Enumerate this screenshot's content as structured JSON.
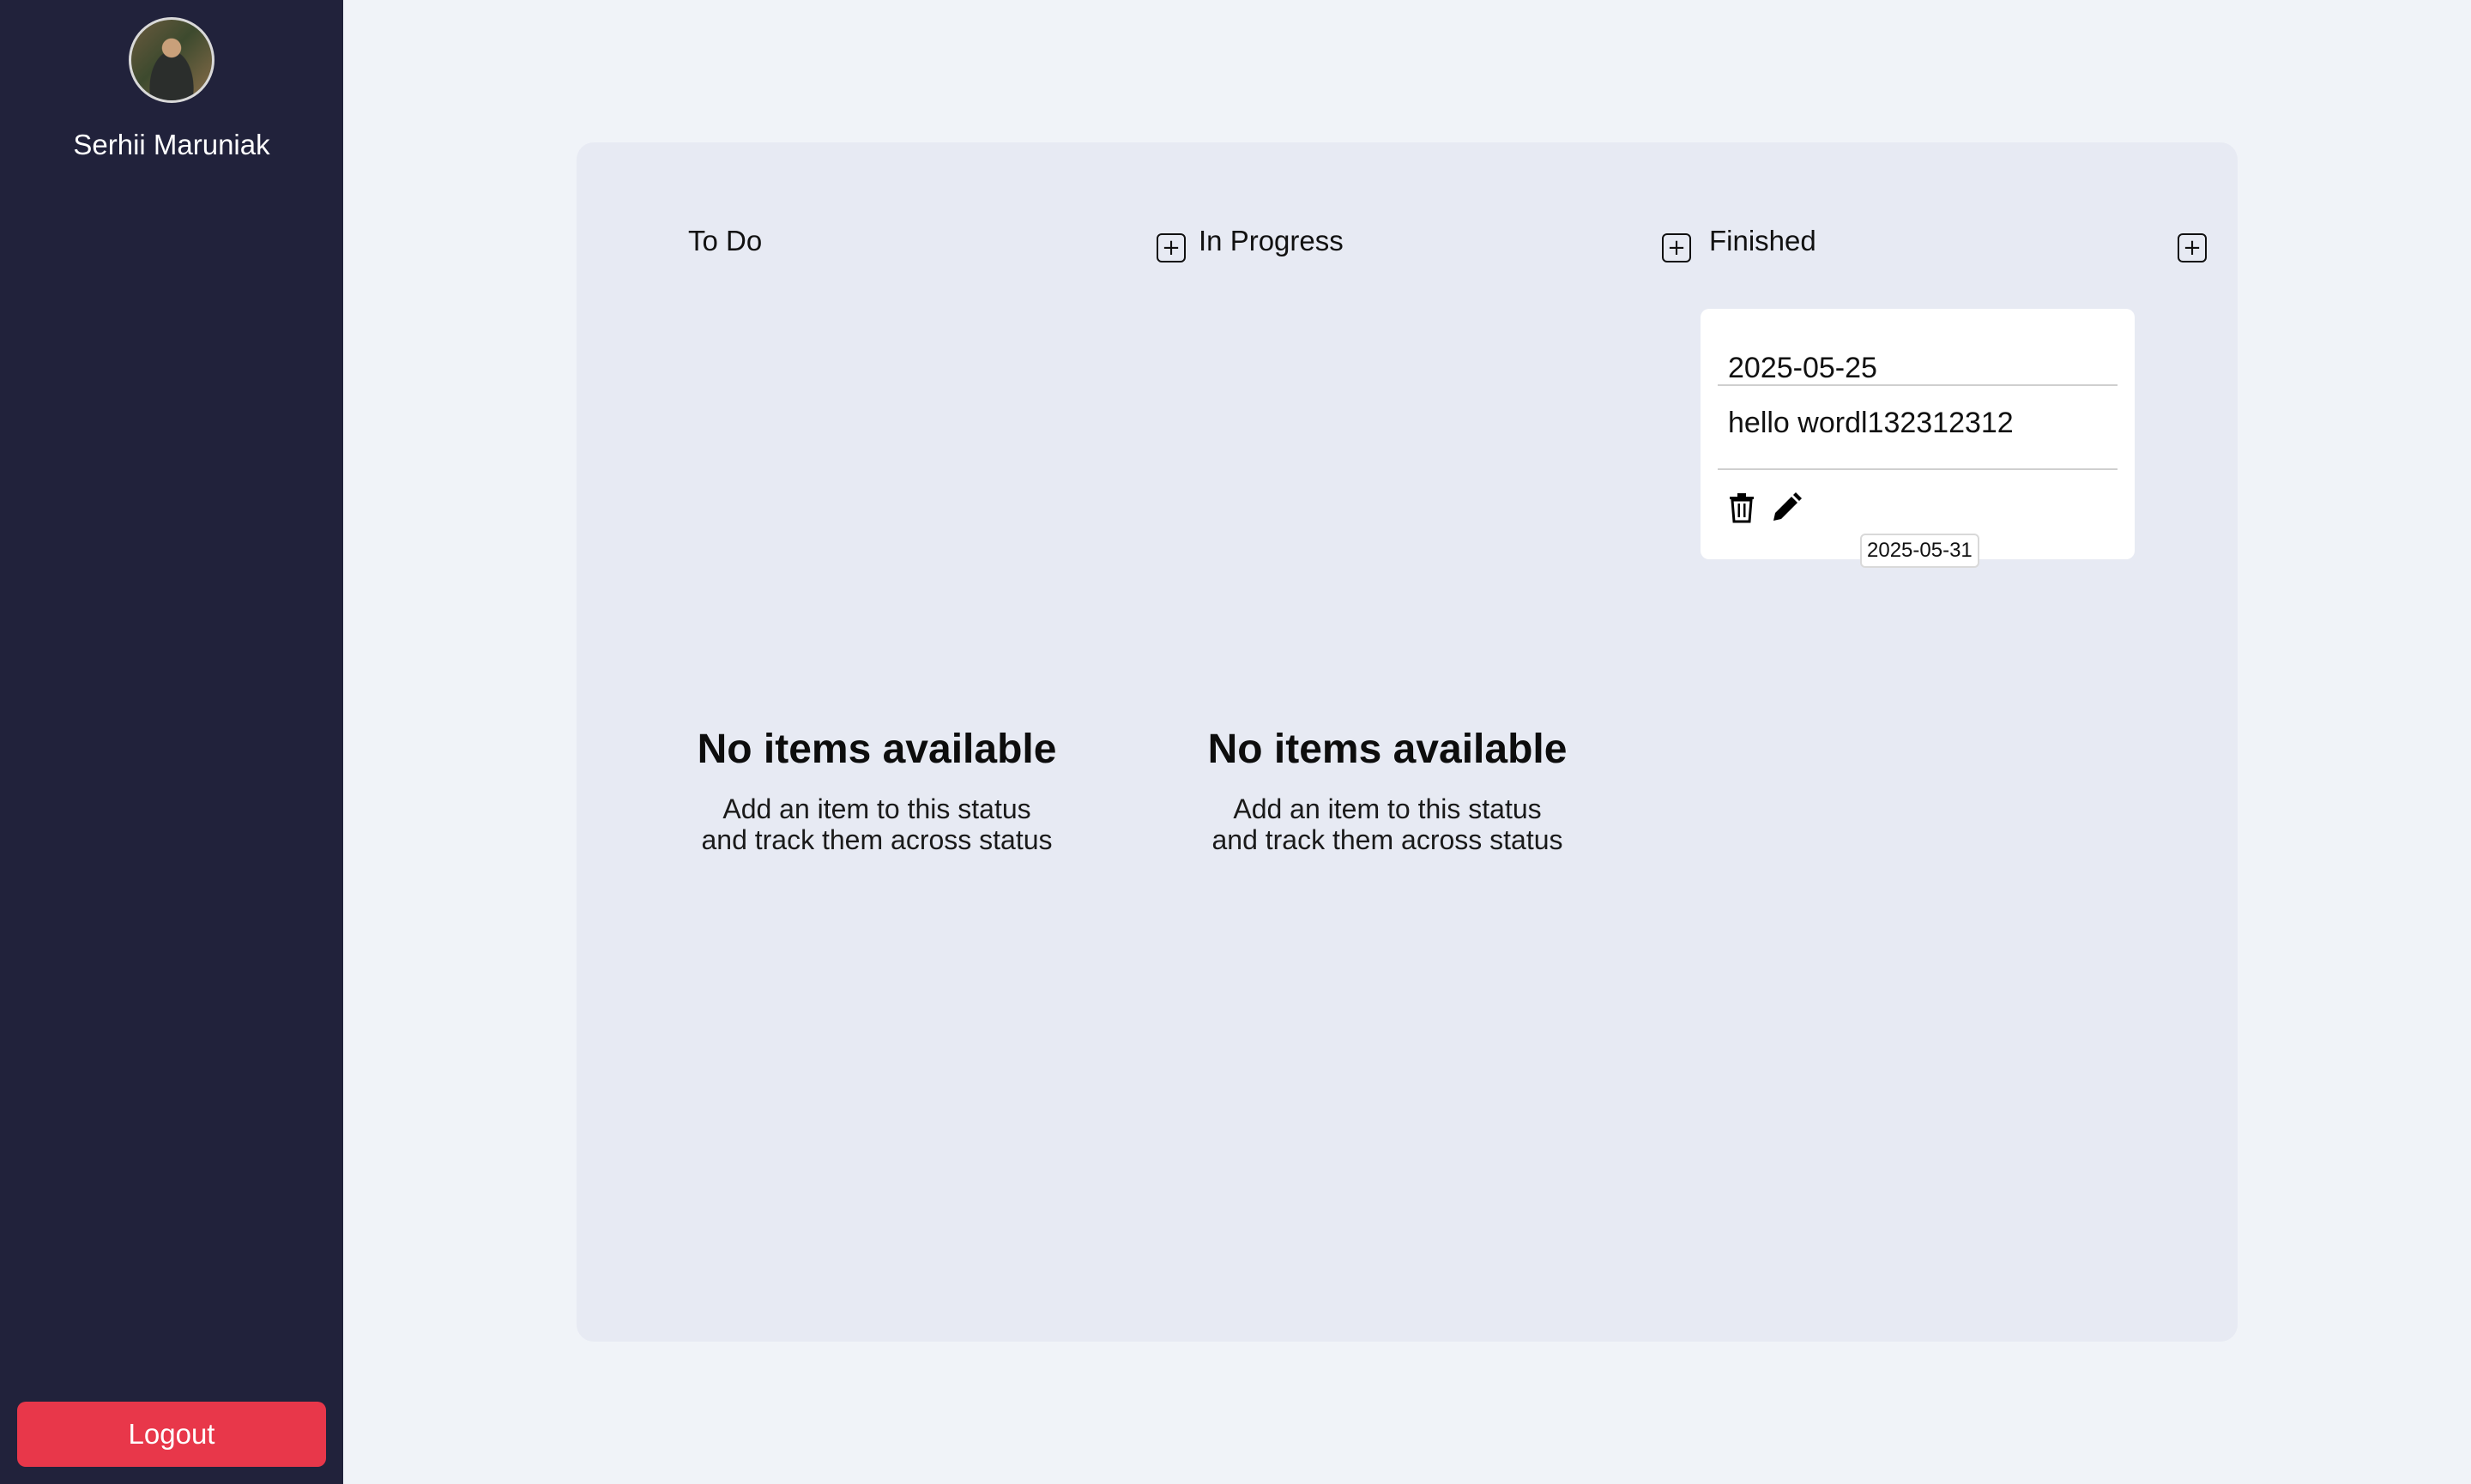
{
  "sidebar": {
    "user_name": "Serhii Maruniak",
    "logout_label": "Logout"
  },
  "board": {
    "columns": [
      {
        "title": "To Do",
        "add_symbol": "+",
        "empty_title": "No items available",
        "empty_desc": "Add an item to this status and track them across status"
      },
      {
        "title": "In Progress",
        "add_symbol": "+",
        "empty_title": "No items available",
        "empty_desc": "Add an item to this status and track them across status"
      },
      {
        "title": "Finished",
        "add_symbol": "+",
        "cards": [
          {
            "date": "2025-05-25",
            "text": "hello wordl132312312",
            "due_date": "2025-05-31"
          }
        ]
      }
    ]
  },
  "colors": {
    "sidebar_bg": "#21223b",
    "page_bg": "#f0f3f8",
    "board_bg": "#e7eaf3",
    "logout_bg": "#e8374a",
    "card_bg": "#ffffff"
  },
  "icons": {
    "add": "plus-square-icon",
    "delete": "trash-icon",
    "edit": "pencil-icon"
  }
}
